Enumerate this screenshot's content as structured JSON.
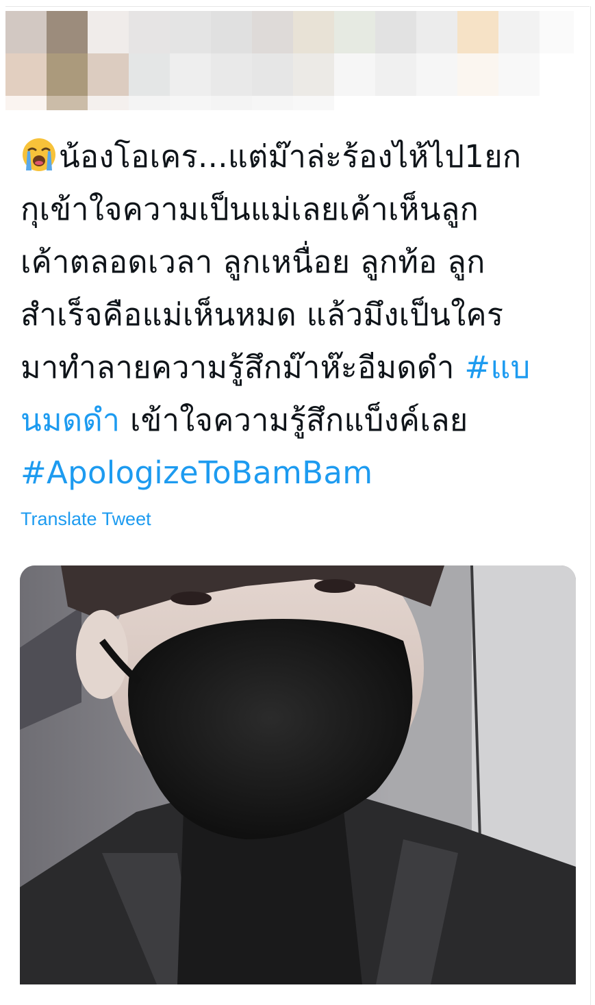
{
  "tweet": {
    "lines": [
      "น้องโอเคร...แต่ม๊าล่ะร้องไห้ไป1ยก",
      "กุเข้าใจความเป็นแม่เลยเค้าเห็นลูก",
      "เค้าตลอดเวลา ลูกเหนื่อย ลูกท้อ ลูก",
      "สำเร็จคือแม่เห็นหมด แล้วมึงเป็นใคร",
      "มาทำลายความรู้สึกม๊าห๊ะอีมดดำ ",
      "เข้าใจความรู้สึกแบ็งค์เลย"
    ],
    "hashtag_part1": "#แบ",
    "hashtag_part2": "นมดดำ",
    "hashtag_apologize": "#ApologizeToBamBam",
    "emoji": "loudly-crying-face-icon",
    "translate_label": "Translate Tweet"
  },
  "media": {
    "type": "video-still",
    "subject": "person-wearing-black-mask"
  },
  "colors": {
    "text": "#0f1419",
    "link": "#1d9bf0",
    "background": "#ffffff"
  }
}
